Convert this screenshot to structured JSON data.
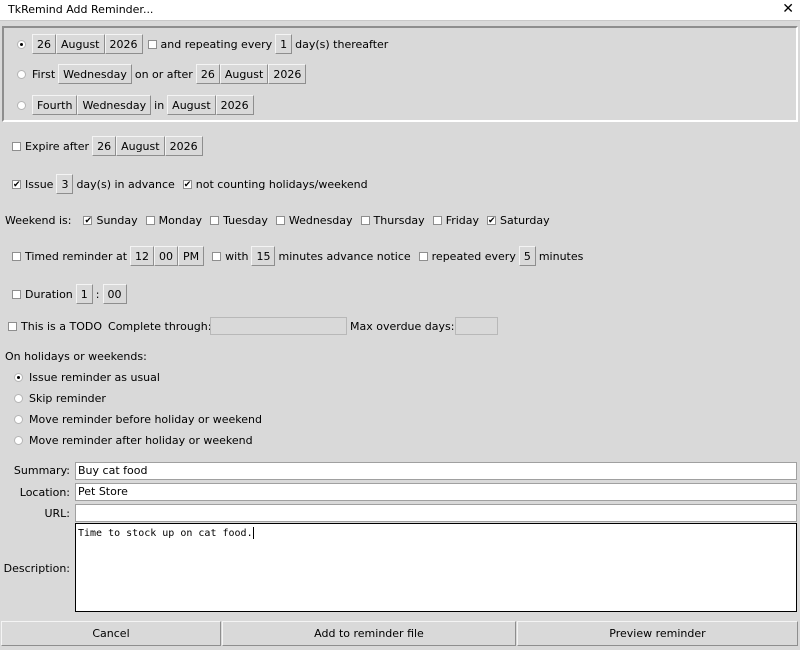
{
  "window": {
    "title": "TkRemind Add Reminder...",
    "close_glyph": "✕"
  },
  "date_group": {
    "row1": {
      "day": "26",
      "month": "August",
      "year": "2026",
      "repeat_label": "and repeating every",
      "repeat_value": "1",
      "repeat_suffix": "day(s) thereafter"
    },
    "row2": {
      "label": "First",
      "weekday": "Wednesday",
      "on_or_after": "on or after",
      "day": "26",
      "month": "August",
      "year": "2026"
    },
    "row3": {
      "ordinal": "Fourth",
      "weekday": "Wednesday",
      "in_label": "in",
      "month": "August",
      "year": "2026"
    }
  },
  "expire": {
    "label": "Expire after",
    "day": "26",
    "month": "August",
    "year": "2026"
  },
  "advance": {
    "label": "Issue",
    "value": "3",
    "suffix": "day(s) in advance",
    "not_counting": "not counting holidays/weekend"
  },
  "weekend": {
    "label": "Weekend is:",
    "days": [
      {
        "name": "Sunday",
        "checked": true
      },
      {
        "name": "Monday",
        "checked": false
      },
      {
        "name": "Tuesday",
        "checked": false
      },
      {
        "name": "Wednesday",
        "checked": false
      },
      {
        "name": "Thursday",
        "checked": false
      },
      {
        "name": "Friday",
        "checked": false
      },
      {
        "name": "Saturday",
        "checked": true
      }
    ]
  },
  "timed": {
    "label": "Timed reminder at",
    "hour": "12",
    "minute": "00",
    "ampm": "PM",
    "with_label": "with",
    "advance": "15",
    "advance_suffix": "minutes advance notice",
    "repeated_label": "repeated every",
    "repeat_value": "5",
    "repeat_suffix": "minutes"
  },
  "duration": {
    "label": "Duration",
    "hours": "1",
    "sep": ":",
    "minutes": "00"
  },
  "todo": {
    "label": "This is a TODO",
    "complete_label": "Complete through:",
    "complete_value": "",
    "overdue_label": "Max overdue days:",
    "overdue_value": ""
  },
  "holidays": {
    "heading": "On holidays or weekends:",
    "options": [
      {
        "label": "Issue reminder as usual",
        "selected": true
      },
      {
        "label": "Skip reminder",
        "selected": false
      },
      {
        "label": "Move reminder before holiday or weekend",
        "selected": false
      },
      {
        "label": "Move reminder after holiday or weekend",
        "selected": false
      }
    ]
  },
  "fields": {
    "summary_label": "Summary:",
    "summary_value": "Buy cat food",
    "location_label": "Location:",
    "location_value": "Pet Store",
    "url_label": "URL:",
    "url_value": "",
    "description_label": "Description:",
    "description_value": "Time to stock up on cat food."
  },
  "buttons": {
    "cancel": "Cancel",
    "add": "Add to reminder file",
    "preview": "Preview reminder"
  }
}
